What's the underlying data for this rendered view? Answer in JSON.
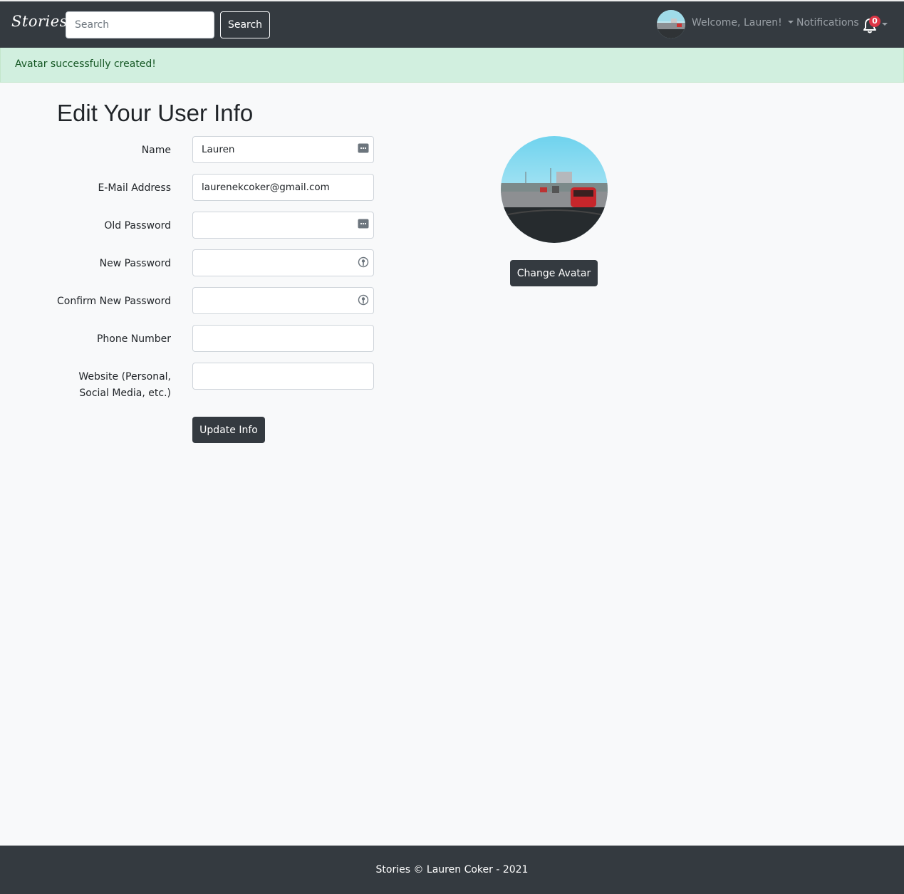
{
  "navbar": {
    "brand": "Stories",
    "search_placeholder": "Search",
    "search_button": "Search",
    "welcome": "Welcome, Lauren!",
    "notifications": "Notifications",
    "notification_count": "0"
  },
  "alert": {
    "message": "Avatar successfully created!"
  },
  "page": {
    "title": "Edit Your User Info"
  },
  "form": {
    "name_label": "Name",
    "name_value": "Lauren",
    "email_label": "E-Mail Address",
    "email_value": "laurenekcoker@gmail.com",
    "old_password_label": "Old Password",
    "new_password_label": "New Password",
    "confirm_password_label": "Confirm New Password",
    "phone_label": "Phone Number",
    "website_label": "Website (Personal, Social Media, etc.)",
    "update_button": "Update Info"
  },
  "avatar": {
    "change_button": "Change Avatar"
  },
  "footer": {
    "text": "Stories © Lauren Coker - 2021"
  },
  "colors": {
    "navbar": "#343a40",
    "alert_bg": "#d1efdf",
    "alert_text": "#155724",
    "badge": "#dc3545",
    "page_bg": "#f8f9fa"
  },
  "icons": {
    "autofill": "password-manager-icon",
    "key": "key-suggest-icon",
    "bell": "bell-icon"
  }
}
